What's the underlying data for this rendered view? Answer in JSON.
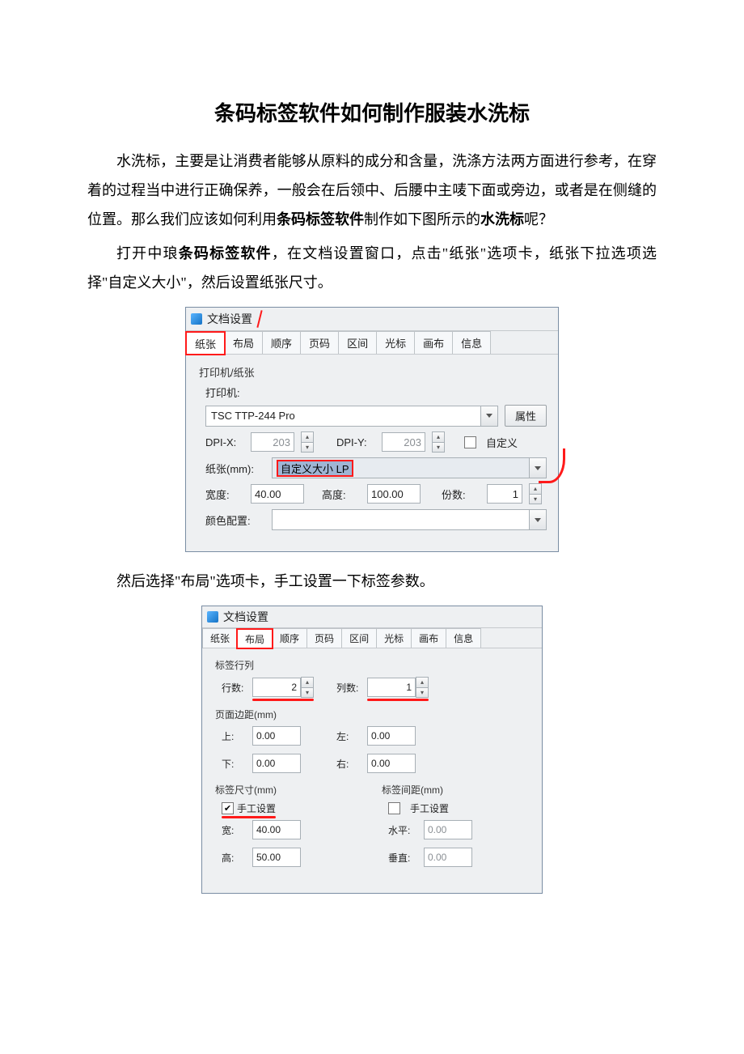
{
  "title": "条码标签软件如何制作服装水洗标",
  "para1a": "水洗标，主要是让消费者能够从原料的成分和含量，洗涤方法两方面进行参考，在穿着的过程当中进行正确保养，一般会在后领中、后腰中主唛下面或旁边，或者是在侧缝的位置。那么我们应该如何利用",
  "para1b_bold": "条码标签软件",
  "para1c": "制作如下图所示的",
  "para1d_bold": "水洗标",
  "para1e": "呢？",
  "para2a": "打开中琅",
  "para2b_bold": "条码标签软件",
  "para2c": "，在文档设置窗口，点击\"纸张\"选项卡，纸张下拉选项选择\"自定义大小\"，然后设置纸张尺寸。",
  "para3": "然后选择\"布局\"选项卡，手工设置一下标签参数。",
  "dlg": {
    "title": "文档设置",
    "tabs": [
      "纸张",
      "布局",
      "顺序",
      "页码",
      "区间",
      "光标",
      "画布",
      "信息"
    ]
  },
  "dlg1": {
    "group_printer": "打印机/纸张",
    "printer_label": "打印机:",
    "printer_value": "TSC TTP-244 Pro",
    "props_btn": "属性",
    "dpix_label": "DPI-X:",
    "dpix_value": "203",
    "dpiy_label": "DPI-Y:",
    "dpiy_value": "203",
    "custom_label": "自定义",
    "paper_label": "纸张(mm):",
    "paper_value": "自定义大小 LP",
    "width_label": "宽度:",
    "width_value": "40.00",
    "height_label": "高度:",
    "height_value": "100.00",
    "copies_label": "份数:",
    "copies_value": "1",
    "color_label": "颜色配置:"
  },
  "dlg2": {
    "group_rc": "标签行列",
    "rows_label": "行数:",
    "rows_value": "2",
    "cols_label": "列数:",
    "cols_value": "1",
    "group_margin": "页面边距(mm)",
    "top_label": "上:",
    "top_value": "0.00",
    "left_label": "左:",
    "left_value": "0.00",
    "bottom_label": "下:",
    "bottom_value": "0.00",
    "right_label": "右:",
    "right_value": "0.00",
    "group_size": "标签尺寸(mm)",
    "manual_label": "手工设置",
    "w_label": "宽:",
    "w_value": "40.00",
    "h_label": "高:",
    "h_value": "50.00",
    "group_gap": "标签间距(mm)",
    "hz_label": "水平:",
    "hz_value": "0.00",
    "vt_label": "垂直:",
    "vt_value": "0.00"
  }
}
